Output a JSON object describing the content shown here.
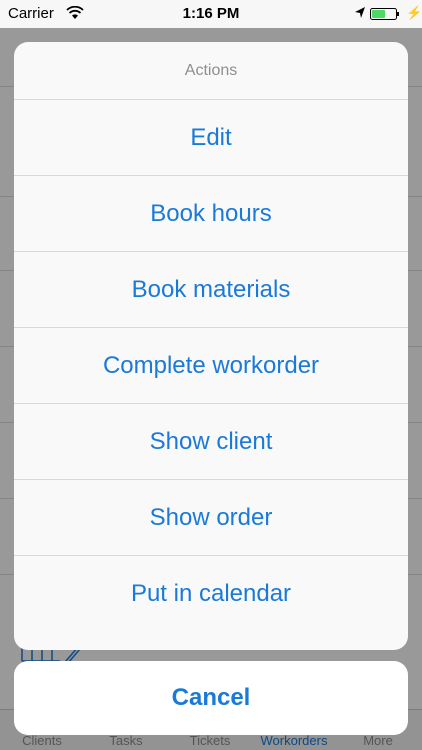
{
  "status_bar": {
    "carrier": "Carrier",
    "time": "1:16 PM",
    "wifi_icon": "wifi-icon",
    "location_icon": "location-arrow-icon",
    "battery_icon": "battery-charging-icon"
  },
  "action_sheet": {
    "title": "Actions",
    "actions": [
      {
        "label": "Edit"
      },
      {
        "label": "Book hours"
      },
      {
        "label": "Book materials"
      },
      {
        "label": "Complete workorder"
      },
      {
        "label": "Show client"
      },
      {
        "label": "Show order"
      },
      {
        "label": "Put in calendar"
      }
    ],
    "cancel_label": "Cancel",
    "accent_color": "#1a7ad9"
  },
  "background_tabbar": {
    "tabs": [
      {
        "label": "Clients"
      },
      {
        "label": "Tasks"
      },
      {
        "label": "Tickets"
      },
      {
        "label": "Workorders",
        "active": true
      },
      {
        "label": "More"
      }
    ]
  }
}
